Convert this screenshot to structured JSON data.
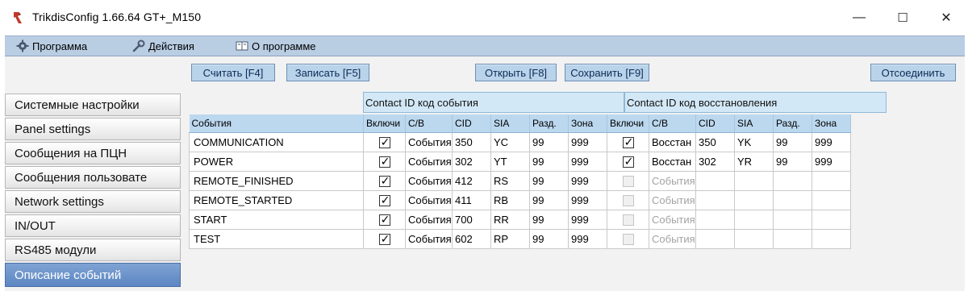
{
  "window": {
    "title": "TrikdisConfig 1.66.64   GT+_M150",
    "controls": {
      "minimize": "—",
      "maximize": "☐",
      "close": "✕"
    }
  },
  "menu": {
    "program": "Программа",
    "actions": "Действия",
    "about": "О программе"
  },
  "toolbar": {
    "read": "Считать [F4]",
    "write": "Записать [F5]",
    "open": "Открыть [F8]",
    "save": "Сохранить [F9]",
    "disconnect": "Отсоединить"
  },
  "sidebar": {
    "items": [
      "Системные настройки",
      "Panel settings",
      "Сообщения на ПЦН",
      "Сообщения пользовате",
      "Network settings",
      "IN/OUT",
      "RS485 модули",
      "Описание событий"
    ],
    "active_index": 7
  },
  "grid": {
    "group_event": "Contact ID код события",
    "group_restore": "Contact ID код восстановления",
    "columns": [
      "События",
      "Включи",
      "С/В",
      "CID",
      "SIA",
      "Разд.",
      "Зона",
      "Включи",
      "С/В",
      "CID",
      "SIA",
      "Разд.",
      "Зона"
    ],
    "rows": [
      {
        "event": "COMMUNICATION",
        "en": true,
        "cb": "События",
        "cid": "350",
        "sia": "YC",
        "part": "99",
        "zone": "999",
        "r_en": true,
        "r_enabled": true,
        "r_cb": "Восстан",
        "r_cid": "350",
        "r_sia": "YK",
        "r_part": "99",
        "r_zone": "999"
      },
      {
        "event": "POWER",
        "en": true,
        "cb": "События",
        "cid": "302",
        "sia": "YT",
        "part": "99",
        "zone": "999",
        "r_en": true,
        "r_enabled": true,
        "r_cb": "Восстан",
        "r_cid": "302",
        "r_sia": "YR",
        "r_part": "99",
        "r_zone": "999"
      },
      {
        "event": "REMOTE_FINISHED",
        "en": true,
        "cb": "События",
        "cid": "412",
        "sia": "RS",
        "part": "99",
        "zone": "999",
        "r_en": false,
        "r_enabled": false,
        "r_cb": "События",
        "r_cid": "",
        "r_sia": "",
        "r_part": "",
        "r_zone": ""
      },
      {
        "event": "REMOTE_STARTED",
        "en": true,
        "cb": "События",
        "cid": "411",
        "sia": "RB",
        "part": "99",
        "zone": "999",
        "r_en": false,
        "r_enabled": false,
        "r_cb": "События",
        "r_cid": "",
        "r_sia": "",
        "r_part": "",
        "r_zone": ""
      },
      {
        "event": "START",
        "en": true,
        "cb": "События",
        "cid": "700",
        "sia": "RR",
        "part": "99",
        "zone": "999",
        "r_en": false,
        "r_enabled": false,
        "r_cb": "События",
        "r_cid": "",
        "r_sia": "",
        "r_part": "",
        "r_zone": ""
      },
      {
        "event": "TEST",
        "en": true,
        "cb": "События",
        "cid": "602",
        "sia": "RP",
        "part": "99",
        "zone": "999",
        "r_en": false,
        "r_enabled": false,
        "r_cb": "События",
        "r_cid": "",
        "r_sia": "",
        "r_part": "",
        "r_zone": ""
      }
    ]
  }
}
